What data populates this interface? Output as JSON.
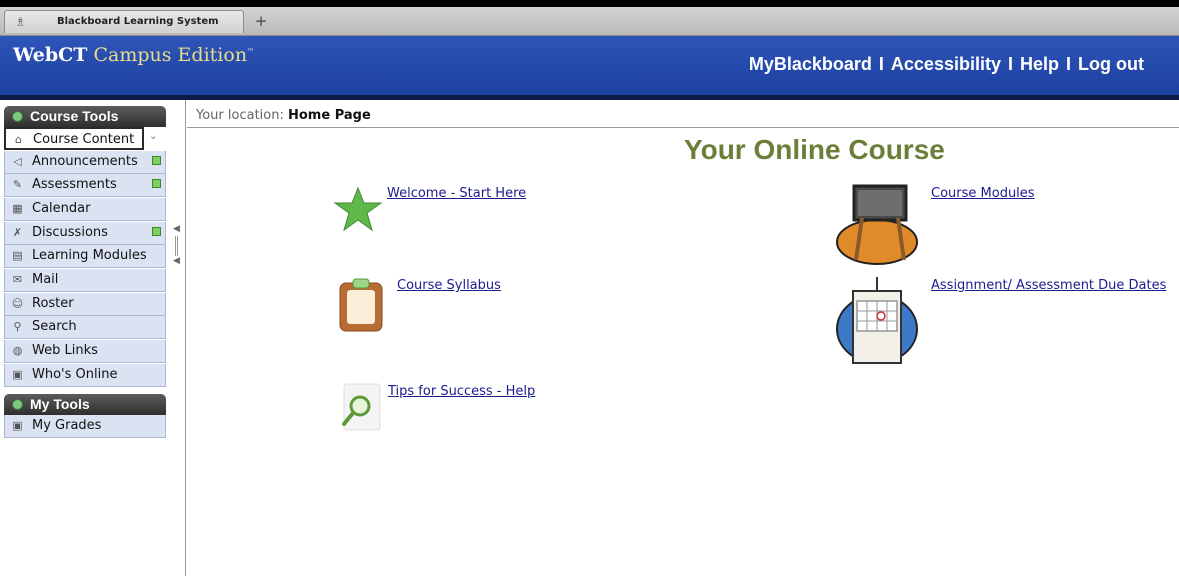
{
  "browser": {
    "tab_title": "Blackboard Learning System",
    "new_tab_label": "+"
  },
  "banner": {
    "brand_bold": "WebCT",
    "brand_rest": "Campus Edition",
    "brand_tm": "™",
    "nav": [
      "MyBlackboard",
      "Accessibility",
      "Help",
      "Log out"
    ],
    "separator": "I"
  },
  "sidebar": {
    "course_tools_title": "Course Tools",
    "items": [
      {
        "label": "Course Content",
        "icon": "home-icon",
        "badge": false
      },
      {
        "label": "Announcements",
        "icon": "megaphone-icon",
        "badge": true
      },
      {
        "label": "Assessments",
        "icon": "assessment-icon",
        "badge": true
      },
      {
        "label": "Calendar",
        "icon": "calendar-icon",
        "badge": false
      },
      {
        "label": "Discussions",
        "icon": "pin-icon",
        "badge": true
      },
      {
        "label": "Learning Modules",
        "icon": "modules-icon",
        "badge": false
      },
      {
        "label": "Mail",
        "icon": "mail-icon",
        "badge": false
      },
      {
        "label": "Roster",
        "icon": "people-icon",
        "badge": false
      },
      {
        "label": "Search",
        "icon": "search-icon",
        "badge": false
      },
      {
        "label": "Web Links",
        "icon": "globe-icon",
        "badge": false
      },
      {
        "label": "Who's Online",
        "icon": "online-icon",
        "badge": false
      }
    ],
    "my_tools_title": "My Tools",
    "my_tools_items": [
      {
        "label": "My Grades",
        "icon": "grades-icon"
      }
    ]
  },
  "main": {
    "location_prefix": "Your location:",
    "location_page": "Home Page",
    "course_title": "Your Online Course",
    "links": {
      "welcome": "Welcome - Start Here",
      "modules": "Course Modules",
      "syllabus": "Course Syllabus",
      "due_dates": "Assignment/ Assessment Due Dates",
      "tips": "Tips for Success - Help"
    }
  },
  "colors": {
    "banner_blue": "#1f45a6",
    "course_title_green": "#6b7f38",
    "link_blue": "#1c1c8c",
    "badge_green": "#7ccf5c"
  }
}
